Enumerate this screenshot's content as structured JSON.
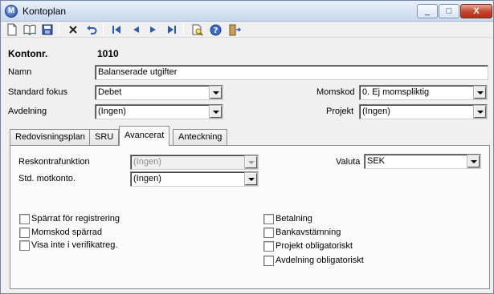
{
  "window": {
    "title": "Kontoplan",
    "app_icon_letter": "M",
    "minimize_glyph": "_",
    "maximize_glyph": "□",
    "close_glyph": "X"
  },
  "toolbar": {
    "icons": [
      "new-document-icon",
      "open-book-icon",
      "save-icon",
      "delete-x-icon",
      "undo-icon",
      "first-record-icon",
      "previous-record-icon",
      "next-record-icon",
      "last-record-icon",
      "print-preview-icon",
      "help-icon",
      "exit-door-icon"
    ]
  },
  "form": {
    "konto_label": "Kontonr.",
    "konto_value": "1010",
    "namn_label": "Namn",
    "namn_value": "Balanserade utgifter",
    "standard_fokus_label": "Standard fokus",
    "standard_fokus_value": "Debet",
    "momskod_label": "Momskod",
    "momskod_value": "0. Ej momspliktig",
    "avdelning_label": "Avdelning",
    "avdelning_value": "(Ingen)",
    "projekt_label": "Projekt",
    "projekt_value": "(Ingen)"
  },
  "tabs": [
    {
      "label": "Redovisningsplan"
    },
    {
      "label": "SRU"
    },
    {
      "label": "Avancerat"
    },
    {
      "label": "Anteckning"
    }
  ],
  "active_tab": "Avancerat",
  "advanced": {
    "reskontra_label": "Reskontrafunktion",
    "reskontra_value": "(Ingen)",
    "motkonto_label": "Std. motkonto.",
    "motkonto_value": "(Ingen)",
    "valuta_label": "Valuta",
    "valuta_value": "SEK",
    "checkboxes_left": [
      {
        "label": "Spärrat för registrering",
        "checked": false
      },
      {
        "label": "Momskod spärrad",
        "checked": false
      },
      {
        "label": "Visa inte i verifikatreg.",
        "checked": false
      }
    ],
    "checkboxes_right": [
      {
        "label": "Betalning",
        "checked": false
      },
      {
        "label": "Bankavstämning",
        "checked": false
      },
      {
        "label": "Projekt obligatoriskt",
        "checked": false
      },
      {
        "label": "Avdelning obligatoriskt",
        "checked": false
      }
    ]
  },
  "colors": {
    "title_bar": "#d4e1f2",
    "close_button": "#c3432a",
    "window_bg": "#f0f0f0"
  }
}
